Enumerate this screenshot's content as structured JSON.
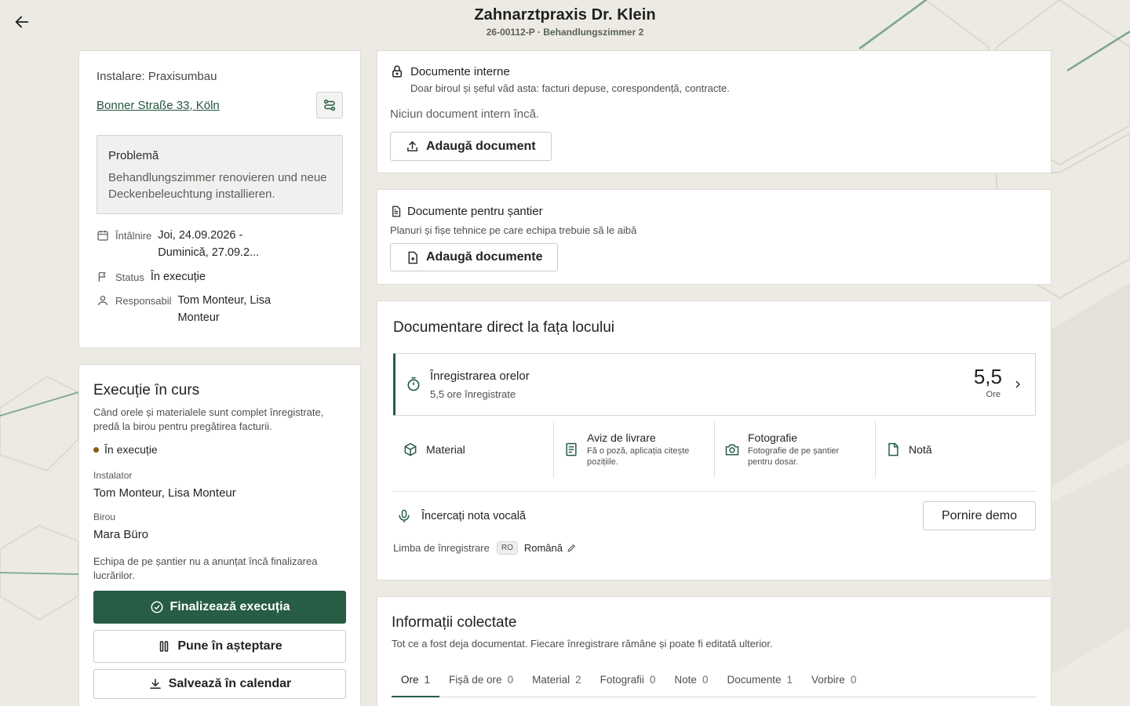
{
  "header": {
    "title": "Zahnarztpraxis Dr. Klein",
    "subtitle": "26-00112-P · Behandlungszimmer 2"
  },
  "job": {
    "install_label": "Instalare: Praxisumbau",
    "address": "Bonner Straße 33, Köln",
    "problem_title": "Problemă",
    "problem_text": "Behandlungszimmer renovieren und neue Deckenbeleuchtung installieren.",
    "appointment_label": "Întâlnire",
    "appointment_value": "Joi, 24.09.2026 - Duminică, 27.09.2...",
    "status_label": "Status",
    "status_value": "În execuție",
    "responsible_label": "Responsabil",
    "responsible_value": "Tom Monteur, Lisa Monteur"
  },
  "execution": {
    "title": "Execuție în curs",
    "description": "Când orele și materialele sunt complet înregistrate, predă la birou pentru pregătirea facturii.",
    "status": "În execuție",
    "installer_label": "Instalator",
    "installer_value": "Tom Monteur, Lisa Monteur",
    "office_label": "Birou",
    "office_value": "Mara Büro",
    "note": "Echipa de pe șantier nu a anunțat încă finalizarea lucrărilor.",
    "finish_button": "Finalizează execuția",
    "pause_button": "Pune în așteptare",
    "calendar_button": "Salvează în calendar"
  },
  "internal_docs": {
    "title": "Documente interne",
    "subtitle": "Doar biroul și șeful văd asta: facturi depuse, corespondență, contracte.",
    "empty": "Niciun document intern încă.",
    "add_button": "Adaugă document"
  },
  "site_docs": {
    "title": "Documente pentru șantier",
    "subtitle": "Planuri și fișe tehnice pe care echipa trebuie să le aibă",
    "add_button": "Adaugă documente"
  },
  "onsite": {
    "title": "Documentare direct la fața locului",
    "hours_title": "Înregistrarea orelor",
    "hours_sub": "5,5 ore înregistrate",
    "hours_value": "5,5",
    "hours_unit": "Ore",
    "tiles": [
      {
        "label": "Material",
        "sub": "",
        "icon": "box-icon"
      },
      {
        "label": "Aviz de livrare",
        "sub": "Fă o poză, aplicația citește pozițiile.",
        "icon": "document-list-icon"
      },
      {
        "label": "Fotografie",
        "sub": "Fotografie de pe șantier pentru dosar.",
        "icon": "camera-icon"
      },
      {
        "label": "Notă",
        "sub": "",
        "icon": "note-icon"
      }
    ],
    "voice_label": "Încercați nota vocală",
    "demo_button": "Pornire demo",
    "lang_label": "Limba de înregistrare",
    "lang_code": "RO",
    "lang_name": "Română"
  },
  "collected": {
    "title": "Informații colectate",
    "description": "Tot ce a fost deja documentat. Fiecare înregistrare rămâne și poate fi editată ulterior.",
    "tabs": [
      {
        "label": "Ore",
        "count": "1"
      },
      {
        "label": "Fișă de ore",
        "count": "0"
      },
      {
        "label": "Material",
        "count": "2"
      },
      {
        "label": "Fotografii",
        "count": "0"
      },
      {
        "label": "Note",
        "count": "0"
      },
      {
        "label": "Documente",
        "count": "1"
      },
      {
        "label": "Vorbire",
        "count": "0"
      }
    ]
  },
  "colors": {
    "accent": "#275c45",
    "status_dot": "#8a5a14",
    "background": "#eceae3"
  }
}
